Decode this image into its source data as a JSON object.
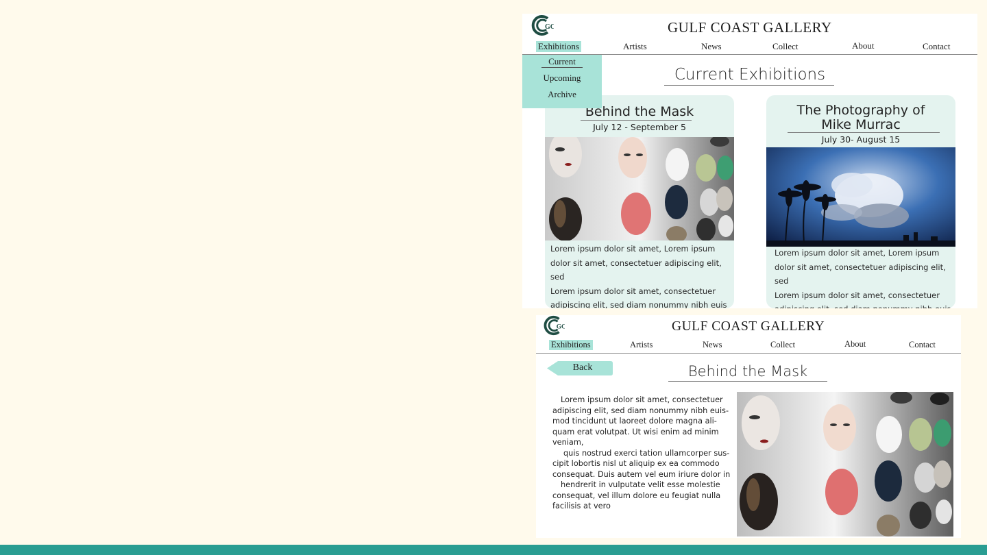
{
  "brand": {
    "name": "GULF COAST GALLERY",
    "logo_icon": "gulf-coast-gallery-logo",
    "logo_text": "GCG"
  },
  "colors": {
    "background": "#fffaec",
    "accent": "#a8e3d8",
    "card": "#e4f3ef",
    "footer": "#2a9d92"
  },
  "nav": [
    "Exhibitions",
    "Artists",
    "News",
    "Collect",
    "About",
    "Contact"
  ],
  "nav_active": "Exhibitions",
  "exhibitions_menu": [
    "Current",
    "Upcoming",
    "Archive"
  ],
  "list_page": {
    "heading": "Current Exhibitions",
    "cards": [
      {
        "title": "Behind the Mask",
        "date": "July 12 - September 5",
        "image": "mask-wall-photo",
        "body": [
          "Lorem ipsum dolor sit amet, Lorem ipsum",
          "dolor sit amet, consectetuer adipiscing elit, sed",
          "Lorem ipsum dolor sit amet, consectetuer",
          "adipiscing elit, sed diam nonummy nibh euis"
        ]
      },
      {
        "title_line1": "The Photography of",
        "title_line2": "Mike Murrac",
        "date": "July 30- August 15",
        "image": "palm-trees-sky-photo",
        "body": [
          "Lorem ipsum dolor sit amet, Lorem ipsum",
          "dolor sit amet, consectetuer adipiscing elit, sed",
          "Lorem ipsum dolor sit amet, consectetuer",
          "adipiscing elit, sed diam nonummy nibh euis"
        ]
      }
    ]
  },
  "detail_page": {
    "back_label": "Back",
    "heading": "Behind the Mask",
    "image": "mask-wall-photo",
    "text_lines": [
      "Lorem ipsum dolor sit amet, consectetuer",
      "adipiscing elit, sed diam nonummy nibh euis-",
      "mod tincidunt ut laoreet dolore magna ali-",
      "quam erat volutpat. Ut wisi enim ad minim",
      "veniam,",
      "quis nostrud exerci tation ullamcorper sus-",
      "cipit lobortis nisl ut aliquip ex ea commodo",
      "consequat. Duis autem vel eum iriure dolor in",
      "hendrerit in vulputate velit esse molestie",
      "consequat, vel illum dolore eu feugiat nulla",
      "facilisis at vero"
    ]
  }
}
